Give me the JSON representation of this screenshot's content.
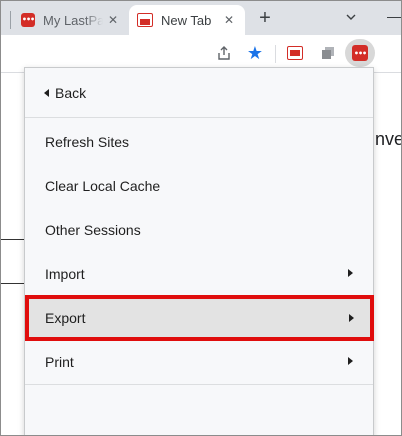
{
  "tabs": [
    {
      "title": "My LastPass Vault",
      "close": "✕",
      "favicon": "lastpass-icon"
    },
    {
      "title": "New Tab",
      "close": "✕",
      "favicon": "pdf-icon"
    }
  ],
  "tabstrip": {
    "new_tab": "+",
    "search": "⌄"
  },
  "toolbar": {
    "star": "★"
  },
  "page": {
    "partial_text": "nve"
  },
  "menu": {
    "back": "Back",
    "items": [
      {
        "label": "Refresh Sites",
        "submenu": false
      },
      {
        "label": "Clear Local Cache",
        "submenu": false
      },
      {
        "label": "Other Sessions",
        "submenu": false
      },
      {
        "label": "Import",
        "submenu": true
      },
      {
        "label": "Export",
        "submenu": true,
        "highlighted": true
      },
      {
        "label": "Print",
        "submenu": true
      }
    ]
  },
  "colors": {
    "lastpass_red": "#d32d27",
    "highlight_border": "#e00d0d",
    "star_blue": "#1a73e8"
  }
}
